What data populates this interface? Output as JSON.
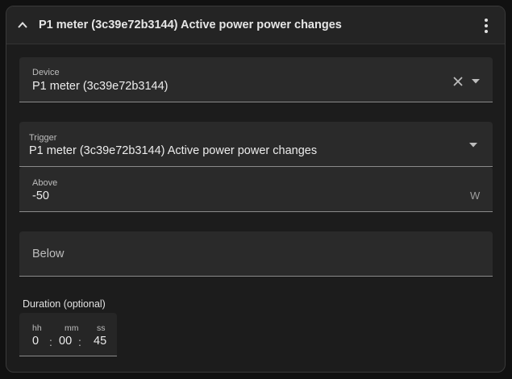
{
  "header": {
    "title": "P1 meter (3c39e72b3144) Active power power changes",
    "collapse_icon": "chevron-up-icon",
    "menu_icon": "dots-vertical-icon"
  },
  "device": {
    "label": "Device",
    "value": "P1 meter (3c39e72b3144)"
  },
  "trigger": {
    "label": "Trigger",
    "value": "P1 meter (3c39e72b3144) Active power power changes"
  },
  "above": {
    "label": "Above",
    "value": "-50",
    "unit": "W"
  },
  "below": {
    "placeholder": "Below"
  },
  "duration": {
    "label": "Duration (optional)",
    "hours_label": "hh",
    "minutes_label": "mm",
    "seconds_label": "ss",
    "hours": "0",
    "minutes": "00",
    "seconds": "45",
    "separator": ":"
  },
  "colors": {
    "background": "#111111",
    "card": "#1c1c1c",
    "field": "#2a2a2a",
    "text": "#e1e1e1"
  }
}
